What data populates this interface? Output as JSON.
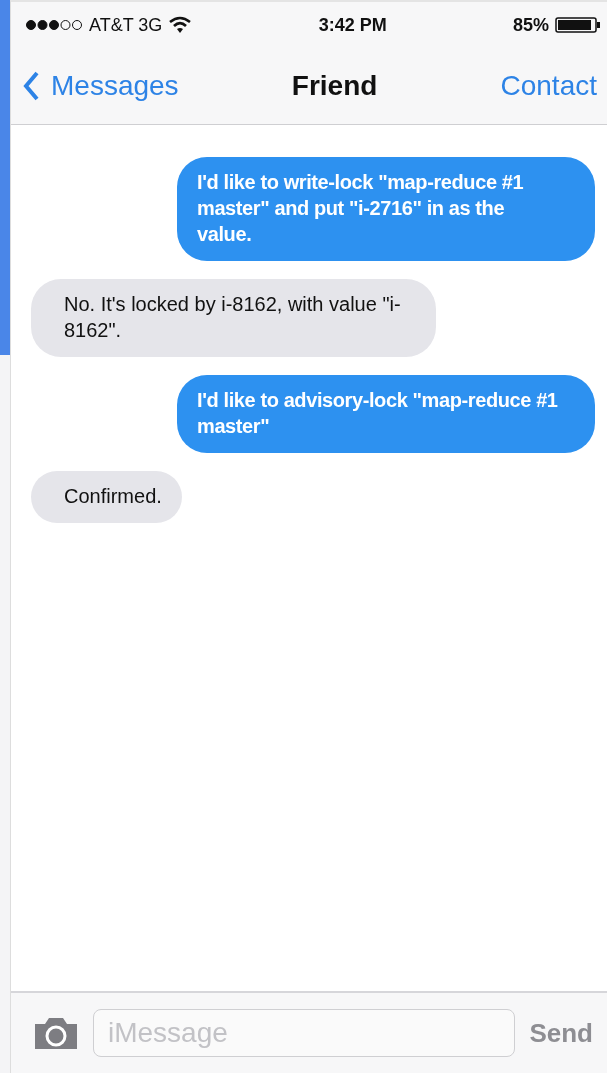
{
  "status_bar": {
    "carrier": "AT&T 3G",
    "time": "3:42 PM",
    "battery": "85%"
  },
  "nav": {
    "back": "Messages",
    "title": "Friend",
    "action": "Contact"
  },
  "messages": [
    {
      "kind": "sent",
      "text": "I'd like to write-lock \"map-reduce #1 master\" and put \"i-2716\" in as the value."
    },
    {
      "kind": "received",
      "text": "No. It's locked by i-8162, with value \"i-8162\"."
    },
    {
      "kind": "sent",
      "text": "I'd like to advisory-lock \"map-reduce #1 master\""
    },
    {
      "kind": "received",
      "text": "Confirmed."
    }
  ],
  "composer": {
    "placeholder": "iMessage",
    "send": "Send"
  }
}
